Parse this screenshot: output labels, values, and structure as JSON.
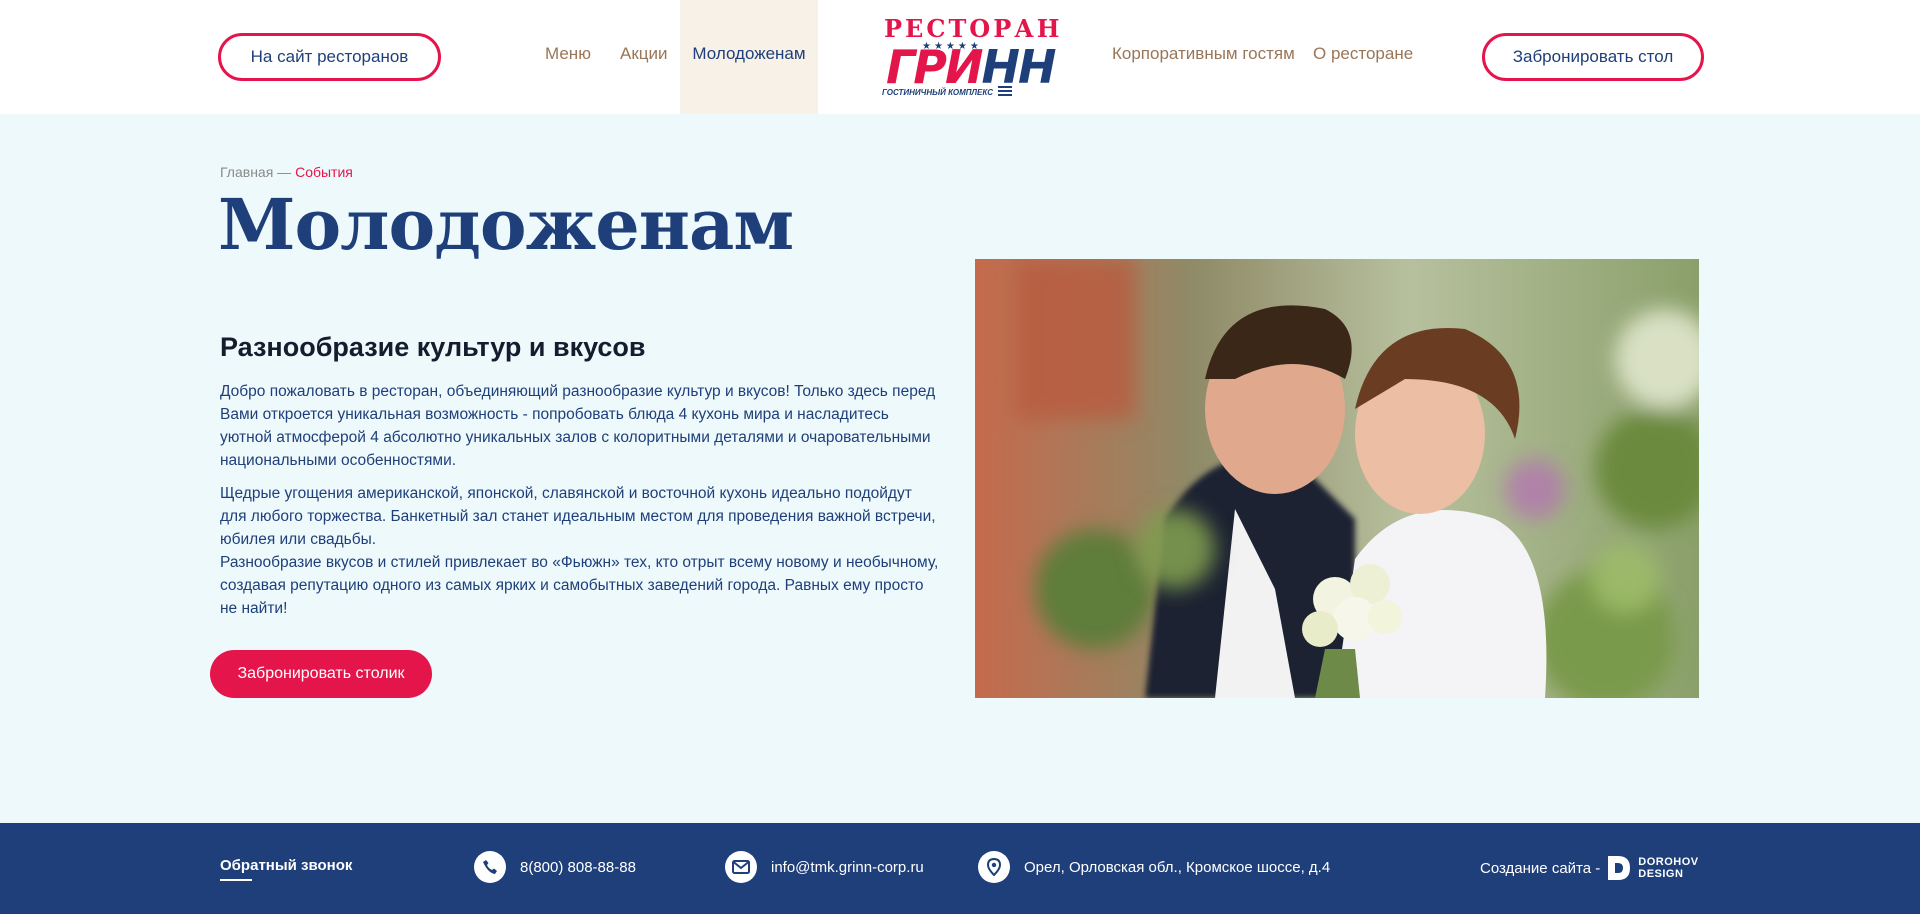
{
  "header": {
    "sites_button": "На сайт ресторанов",
    "book_button": "Забронировать стол",
    "nav": [
      {
        "label": "Меню"
      },
      {
        "label": "Акции"
      },
      {
        "label": "Молодоженам"
      },
      {
        "label": "Корпоративным гостям"
      },
      {
        "label": "О ресторане"
      }
    ],
    "logo": {
      "top": "РЕСТОРАН",
      "main_red": "ГРИ",
      "main_blue": "НН",
      "stars": "★★★★★",
      "sub": "ГОСТИНИЧНЫЙ КОМПЛЕКС"
    }
  },
  "breadcrumb": {
    "home": "Главная",
    "sep": " — ",
    "current": "События"
  },
  "main": {
    "title": "Молодоженам",
    "section_title": "Разнообразие культур и вкусов",
    "para1": "Добро пожаловать в ресторан, объединяющий разнообразие культур и вкусов! Только здесь перед Вами откроется уникальная возможность - попробовать блюда 4 кухонь мира и насладитесь уютной атмосферой 4 абсолютно уникальных залов с колоритными деталями и очаровательными национальными особенностями.",
    "para2": "Щедрые угощения американской, японской, славянской и восточной кухонь идеально подойдут для любого торжества. Банкетный зал станет идеальным местом для проведения важной встречи, юбилея или свадьбы.",
    "para3": "Разнообразие вкусов и стилей привлекает во «Фьюжн» тех, кто отрыт всему новому и необычному, создавая репутацию одного из самых ярких и самобытных заведений города. Равных ему просто не найти!",
    "book_button": "Забронировать столик"
  },
  "footer": {
    "callback": "Обратный звонок",
    "phone": "8(800) 808-88-88",
    "email": "info@tmk.grinn-corp.ru",
    "address": "Орел, Орловская обл., Кромское шоссе, д.4",
    "credit": "Создание сайта -",
    "credit_brand_line1": "DOROHOV",
    "credit_brand_line2": "DESIGN"
  },
  "colors": {
    "accent_red": "#e4154b",
    "brand_blue": "#1e3f7a",
    "page_bg": "#eef9fc",
    "nav_brown": "#9a7658"
  }
}
